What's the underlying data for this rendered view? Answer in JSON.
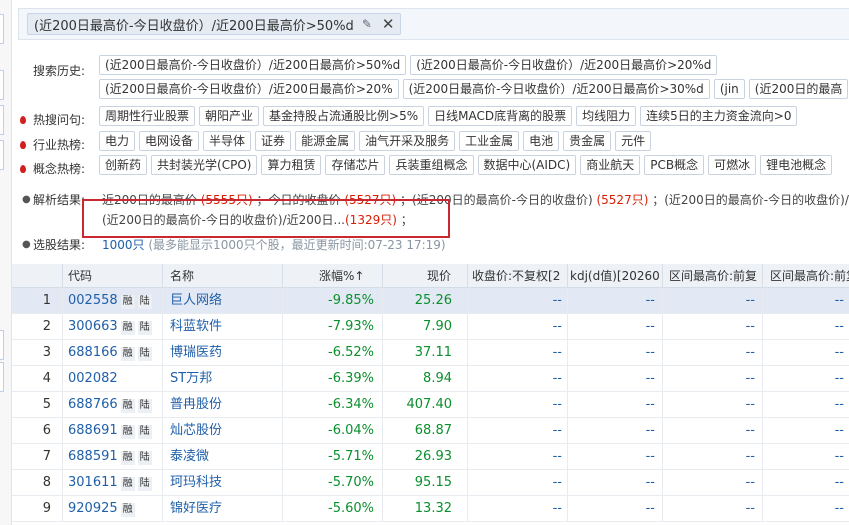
{
  "query": {
    "text": "(近200日最高价-今日收盘价）/近200日最高价>50%d",
    "edit_icon": "edit-icon",
    "close_icon": "close-icon"
  },
  "search_history": {
    "label": "搜索历史:",
    "row1": [
      "(近200日最高价-今日收盘价）/近200日最高价>50%d",
      "(近200日最高价-今日收盘价）/近200日最高价>20%d"
    ],
    "row2": [
      "(近200日最高价-今日收盘价）/近200日最高价>20%",
      "(近200日最高价-今日收盘价）/近200日最高价>30%d",
      "(jin",
      "(近200日的最高"
    ]
  },
  "hot_questions": {
    "label": "热搜问句:",
    "items": [
      "周期性行业股票",
      "朝阳产业",
      "基金持股占流通股比例>5%",
      "日线MACD底背离的股票",
      "均线阻力",
      "连续5日的主力资金流向>0"
    ]
  },
  "industry_hot": {
    "label": "行业热榜:",
    "items": [
      "电力",
      "电网设备",
      "半导体",
      "证券",
      "能源金属",
      "油气开采及服务",
      "工业金属",
      "电池",
      "贵金属",
      "元件"
    ]
  },
  "concept_hot": {
    "label": "概念热榜:",
    "items": [
      "创新药",
      "共封装光学(CPO)",
      "算力租赁",
      "存储芯片",
      "兵装重组概念",
      "数据中心(AIDC)",
      "商业航天",
      "PCB概念",
      "可燃冰",
      "锂电池概念"
    ]
  },
  "parse": {
    "label": "解析结果:",
    "p1": "近200日的最高价",
    "c1": "(5555只)",
    "s1": "；今日的收盘价",
    "c2": "(5527只)",
    "s2": "；(近200日的最高价-今日的收盘价)",
    "c3": "(5527只)",
    "s3": "；(近200日的最高价-今日的收盘价)/近",
    "line2a": "(近200日的最高价-今日的收盘价)/近200日...",
    "c4": "(1329只)",
    "line2b": "；"
  },
  "selection": {
    "label": "选股结果:",
    "count": "1000只",
    "note": "(最多能显示1000只个股，最近更新时间:07-23 17:19)"
  },
  "table": {
    "headers": [
      "代码",
      "名称",
      "涨幅%↑",
      "现价",
      "收盘价:不复权[2",
      "kdj(d值)[20260",
      "区间最高价:前复",
      "区间最高价:前复"
    ],
    "rows": [
      {
        "idx": "1",
        "code": "002558",
        "tags": [
          "融",
          "陆"
        ],
        "name": "巨人网络",
        "chg": "-9.85%",
        "price": "25.26",
        "c1": "--",
        "c2": "--",
        "c3": "--",
        "c4": "--"
      },
      {
        "idx": "2",
        "code": "300663",
        "tags": [
          "融",
          "陆"
        ],
        "name": "科蓝软件",
        "chg": "-7.93%",
        "price": "7.90",
        "c1": "--",
        "c2": "--",
        "c3": "--",
        "c4": "--"
      },
      {
        "idx": "3",
        "code": "688166",
        "tags": [
          "融",
          "陆"
        ],
        "name": "博瑞医药",
        "chg": "-6.52%",
        "price": "37.11",
        "c1": "--",
        "c2": "--",
        "c3": "--",
        "c4": "--"
      },
      {
        "idx": "4",
        "code": "002082",
        "tags": [],
        "name": "ST万邦",
        "chg": "-6.39%",
        "price": "8.94",
        "c1": "--",
        "c2": "--",
        "c3": "--",
        "c4": "--"
      },
      {
        "idx": "5",
        "code": "688766",
        "tags": [
          "融",
          "陆"
        ],
        "name": "普冉股份",
        "chg": "-6.34%",
        "price": "407.40",
        "c1": "--",
        "c2": "--",
        "c3": "--",
        "c4": "--"
      },
      {
        "idx": "6",
        "code": "688691",
        "tags": [
          "融",
          "陆"
        ],
        "name": "灿芯股份",
        "chg": "-6.04%",
        "price": "68.87",
        "c1": "--",
        "c2": "--",
        "c3": "--",
        "c4": "--"
      },
      {
        "idx": "7",
        "code": "688591",
        "tags": [
          "融",
          "陆"
        ],
        "name": "泰凌微",
        "chg": "-5.71%",
        "price": "26.93",
        "c1": "--",
        "c2": "--",
        "c3": "--",
        "c4": "--"
      },
      {
        "idx": "8",
        "code": "301611",
        "tags": [
          "融",
          "陆"
        ],
        "name": "珂玛科技",
        "chg": "-5.70%",
        "price": "95.15",
        "c1": "--",
        "c2": "--",
        "c3": "--",
        "c4": "--"
      },
      {
        "idx": "9",
        "code": "920925",
        "tags": [
          "融"
        ],
        "name": "锦好医疗",
        "chg": "-5.60%",
        "price": "13.32",
        "c1": "--",
        "c2": "--",
        "c3": "--",
        "c4": "--"
      }
    ]
  },
  "colors": {
    "accent": "#1f5fa8",
    "negative": "#0b8f2d",
    "highlight": "#c8282e"
  }
}
